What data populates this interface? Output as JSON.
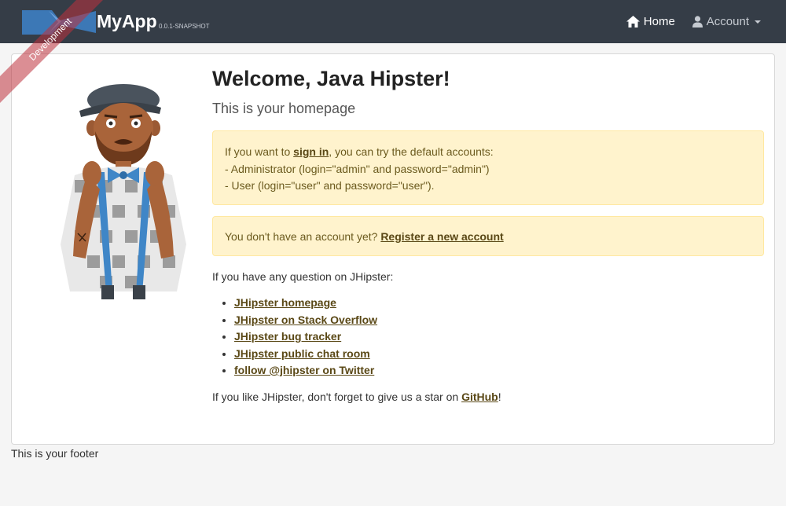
{
  "navbar": {
    "brand_name": "MyApp",
    "version": "0.0.1-SNAPSHOT",
    "ribbon": "Development",
    "home_label": "Home",
    "account_label": "Account",
    "home_icon": "home-icon",
    "account_icon": "user-icon"
  },
  "main": {
    "title": "Welcome, Java Hipster!",
    "subtitle": "This is your homepage",
    "signin_alert": {
      "prefix": "If you want to ",
      "link": "sign in",
      "suffix": ", you can try the default accounts:",
      "line_admin": "- Administrator (login=\"admin\" and password=\"admin\")",
      "line_user": "- User (login=\"user\" and password=\"user\")."
    },
    "register_alert": {
      "prefix": "You don't have an account yet? ",
      "link": "Register a new account"
    },
    "question": "If you have any question on JHipster:",
    "links": [
      "JHipster homepage",
      "JHipster on Stack Overflow",
      "JHipster bug tracker",
      "JHipster public chat room",
      "follow @jhipster on Twitter"
    ],
    "star": {
      "prefix": "If you like JHipster, don't forget to give us a star on ",
      "link": "GitHub",
      "suffix": "!"
    }
  },
  "footer": {
    "text": "This is your footer"
  },
  "colors": {
    "navbar_bg": "#353d47",
    "alert_bg": "#fff3cd",
    "alert_border": "#ffe8a1",
    "link": "#5a4816",
    "ribbon": "#be323c"
  }
}
